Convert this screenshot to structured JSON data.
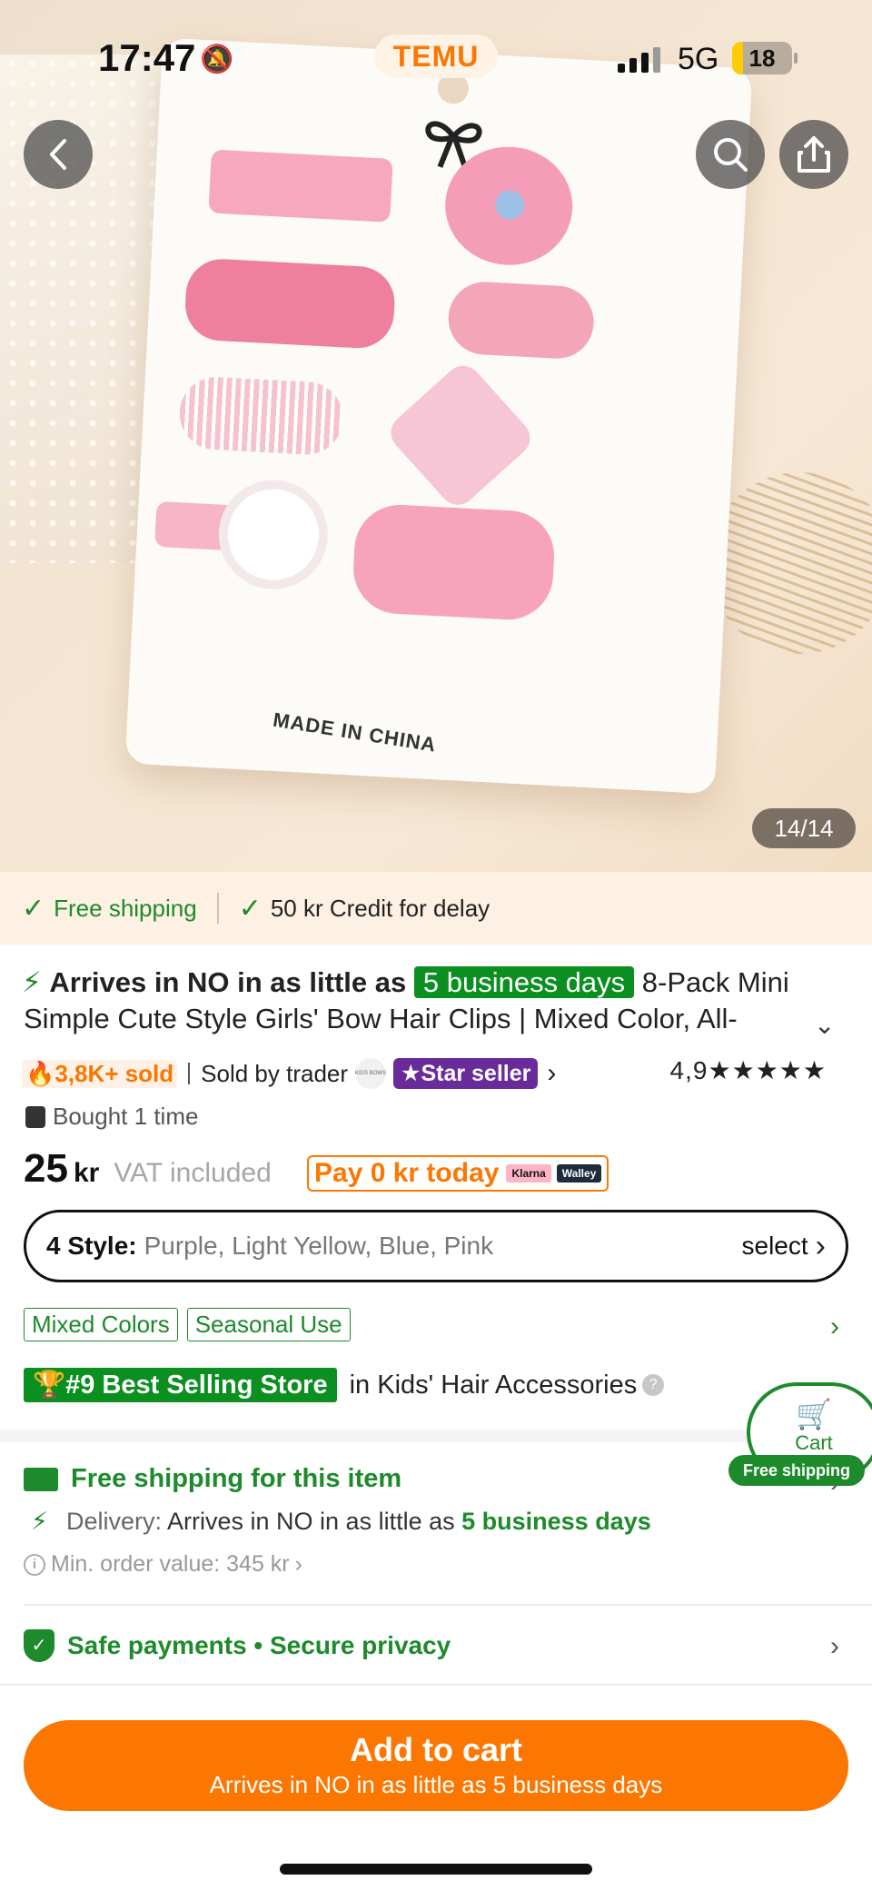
{
  "status_bar": {
    "time": "17:47",
    "network": "5G",
    "battery": "18",
    "battery_level": 0.18,
    "brand": "TEMU"
  },
  "gallery": {
    "counter": "14/14",
    "product_image_text": "MADE IN CHINA"
  },
  "icons": {
    "back": "back-arrow-icon",
    "search": "search-icon",
    "share": "share-icon"
  },
  "perks": {
    "free_shipping": "Free shipping",
    "credit": "50 kr Credit for delay"
  },
  "product": {
    "arrives_prefix": "Arrives in NO in as little as",
    "days_badge": "5 business days",
    "title_part1": "8-Pack Mini",
    "title_line2": "Simple Cute Style Girls' Bow Hair Clips | Mixed Color, All-",
    "sold": "3,8K+ sold",
    "sold_by": "Sold by trader",
    "store_logo": "KIDS BOWS",
    "star_seller": "Star seller",
    "rating": "4,9",
    "stars": "★★★★★",
    "bought": "Bought 1 time"
  },
  "price": {
    "amount": "25",
    "currency": "kr",
    "vat": "VAT included",
    "pay_today": "Pay 0 kr today",
    "klarna": "Klarna",
    "walley": "Walley"
  },
  "style": {
    "label": "4 Style:",
    "options": "Purple, Light Yellow, Blue, Pink",
    "select": "select"
  },
  "tags": [
    "Mixed Colors",
    "Seasonal Use"
  ],
  "best_selling": {
    "badge": "#9 Best Selling Store",
    "category": "in Kids' Hair Accessories"
  },
  "shipping": {
    "title": "Free shipping for this item",
    "delivery_label": "Delivery:",
    "delivery_text": "Arrives in NO in as little as",
    "delivery_days": "5 business days",
    "min_order": "Min. order value: 345 kr"
  },
  "safety": {
    "label": "Safe payments • Secure privacy"
  },
  "cart_float": {
    "label": "Cart",
    "pill": "Free shipping"
  },
  "add_to_cart": {
    "label": "Add to cart",
    "sub": "Arrives in NO in as little as 5 business days"
  },
  "colors": {
    "brand_orange": "#fb7701",
    "green": "#1d8a2b",
    "star_seller_purple": "#6a2b9a"
  }
}
